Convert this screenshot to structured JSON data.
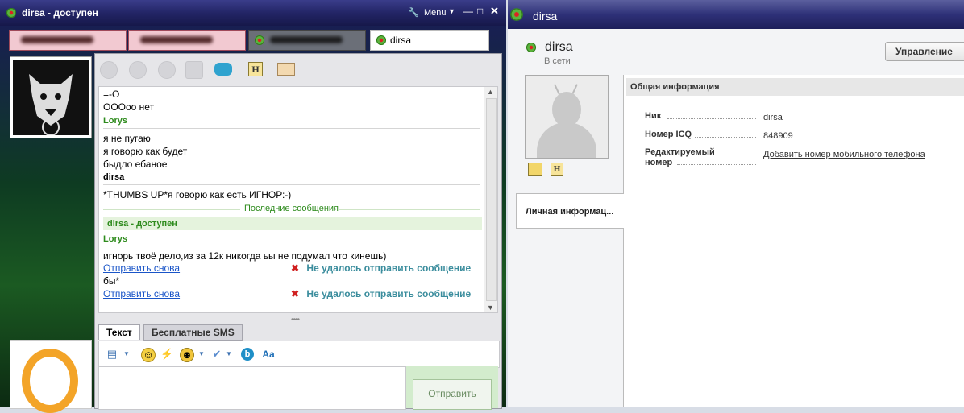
{
  "chat_window": {
    "title": "dirsa - доступен",
    "menu_label": "Menu",
    "tabs": [
      {
        "label": ""
      },
      {
        "label": ""
      },
      {
        "label": ""
      },
      {
        "label": "dirsa"
      }
    ],
    "messages": [
      {
        "text": "=-O"
      },
      {
        "text": "OOOoo нет"
      },
      {
        "sender": "Lorys"
      },
      {
        "text": "я не пугаю"
      },
      {
        "text": "я говорю как будет"
      },
      {
        "text": "быдло ебаное"
      },
      {
        "sender": "dirsa"
      },
      {
        "text": "*THUMBS UP*я говорю как есть ИГНОР:-)"
      }
    ],
    "last_messages_label": "Последние сообщения",
    "status_line": "dirsa - доступен",
    "recent": [
      {
        "sender": "Lorys"
      },
      {
        "text": "игнорь твоё дело,из за 12к никогда ьы не подумал что кинешь)"
      },
      {
        "resend": "Отправить снова",
        "error": "Не удалось отправить сообщение"
      },
      {
        "text": "бы*"
      },
      {
        "resend": "Отправить снова",
        "error": "Не удалось отправить сообщение"
      }
    ],
    "input_tabs": {
      "text": "Текст",
      "sms": "Бесплатные SMS"
    },
    "send_label": "Отправить"
  },
  "profile_window": {
    "title": "dirsa",
    "name": "dirsa",
    "status": "В сети",
    "manage_label": "Управление",
    "personal_tab": "Личная информац...",
    "section_title": "Общая информация",
    "fields": {
      "nick_label": "Ник",
      "nick_value": "dirsa",
      "icq_label": "Номер ICQ",
      "icq_value": "848909",
      "editable_label_1": "Редактируемый",
      "editable_label_2": "номер",
      "add_phone_link": "Добавить номер мобильного телефона"
    }
  },
  "colors": {
    "accent_green": "#2e8b1d",
    "link_blue": "#1a55c8",
    "error_teal": "#3b8d9d",
    "error_x": "#d02020"
  }
}
